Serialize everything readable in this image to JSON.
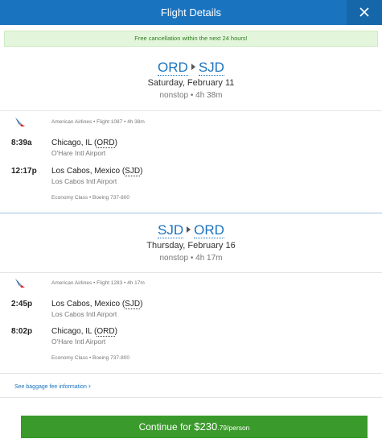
{
  "header": {
    "title": "Flight Details",
    "close_symbol": "×"
  },
  "banner": {
    "text": "Free cancellation within the next 24 hours!"
  },
  "outbound": {
    "origin": "ORD",
    "destination": "SJD",
    "date": "Saturday, February 11",
    "meta": "nonstop • 4h 38m",
    "flight_info": "American Airlines • Flight 1087 • 4h 38m",
    "depart_time": "8:39a",
    "depart_city": "Chicago, IL (",
    "depart_code": "ORD",
    "depart_close": ")",
    "depart_airport": "O'Hare Intl Airport",
    "arrive_time": "12:17p",
    "arrive_city": "Los Cabos, Mexico (",
    "arrive_code": "SJD",
    "arrive_close": ")",
    "arrive_airport": "Los Cabos Intl Airport",
    "cabin": "Economy Class • Boeing 737-800"
  },
  "return": {
    "origin": "SJD",
    "destination": "ORD",
    "date": "Thursday, February 16",
    "meta": "nonstop • 4h 17m",
    "flight_info": "American Airlines • Flight 1283 • 4h 17m",
    "depart_time": "2:45p",
    "depart_city": "Los Cabos, Mexico (",
    "depart_code": "SJD",
    "depart_close": ")",
    "depart_airport": "Los Cabos Intl Airport",
    "arrive_time": "8:02p",
    "arrive_city": "Chicago, IL (",
    "arrive_code": "ORD",
    "arrive_close": ")",
    "arrive_airport": "O'Hare Intl Airport",
    "cabin": "Economy Class • Boeing 737-800"
  },
  "baggage": {
    "link_text": "See baggage fee information",
    "chevron": "›"
  },
  "continue": {
    "prefix": "Continue for ",
    "price_main": "$230",
    "price_cents": ".79",
    "suffix": "/person"
  },
  "colors": {
    "header": "#1a73bf",
    "accent": "#1a73bf",
    "continue_button": "#3a9a2b",
    "banner_bg": "#e3f6dc",
    "banner_text": "#2e7d1e"
  },
  "icons": {
    "close": "close-icon",
    "airline": "american-airlines-logo-icon",
    "route_arrow": "triangle-right-icon"
  }
}
